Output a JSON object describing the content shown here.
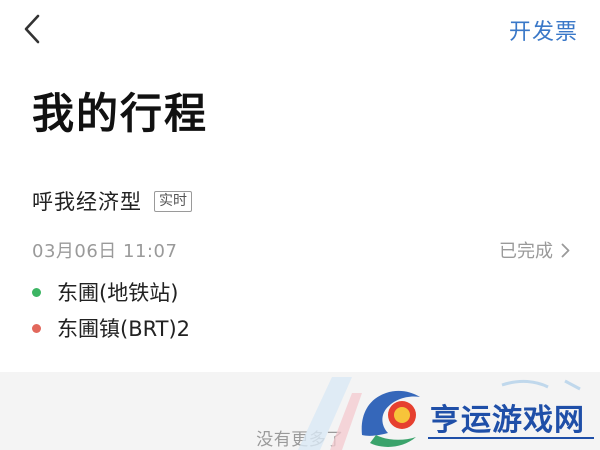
{
  "header": {
    "back_icon": "chevron-left-icon",
    "invoice_label": "开发票"
  },
  "page": {
    "title": "我的行程"
  },
  "trip": {
    "type": "呼我经济型",
    "badge": "实时",
    "datetime": "03月06日  11:07",
    "status": "已完成",
    "status_icon": "chevron-right-icon",
    "origin": "东圃(地铁站)",
    "destination": "东圃镇(BRT)2",
    "origin_color": "#3cb563",
    "destination_color": "#e2685c"
  },
  "footer": {
    "no_more_text": "没有更多了"
  },
  "watermark": {
    "text": "亨运游戏网"
  },
  "colors": {
    "accent": "#3a78c8",
    "muted": "#9a9a9a",
    "footer_bg": "#f4f4f4"
  }
}
